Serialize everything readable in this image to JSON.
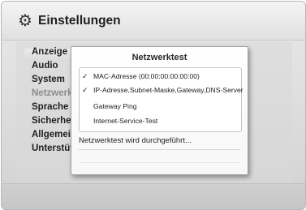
{
  "header": {
    "title": "Einstellungen",
    "icon": "gear-icon"
  },
  "menu": {
    "items": [
      {
        "label": "Anzeige",
        "state": "normal"
      },
      {
        "label": "Audio",
        "state": "normal"
      },
      {
        "label": "System",
        "state": "normal"
      },
      {
        "label": "Netzwerk",
        "state": "dim"
      },
      {
        "label": "Sprache",
        "state": "normal"
      },
      {
        "label": "Sicherheit",
        "state": "normal"
      },
      {
        "label": "Allgemein",
        "state": "normal"
      },
      {
        "label": "Unterstützung",
        "state": "normal"
      }
    ]
  },
  "dialog": {
    "title": "Netzwerktest",
    "results": [
      {
        "check": "✓",
        "label": "MAC-Adresse (00:00:00:00:00:00)"
      },
      {
        "check": "✓",
        "label": "IP-Adresse,Subnet-Maske,Gateway,DNS-Server"
      },
      {
        "check": "",
        "label": "Gateway Ping"
      },
      {
        "check": "",
        "label": "Internet-Service-Test"
      }
    ],
    "status": "Netzwerktest wird durchgeführt..."
  }
}
